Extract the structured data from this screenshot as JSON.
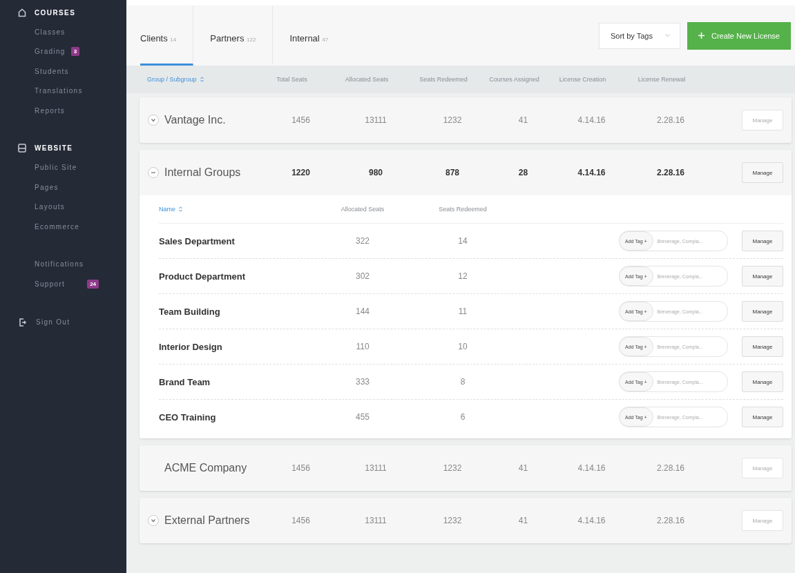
{
  "sidebar": {
    "sections": [
      {
        "title": "COURSES",
        "items": [
          {
            "label": "Classes"
          },
          {
            "label": "Grading",
            "badge": "3"
          },
          {
            "label": "Students"
          },
          {
            "label": "Translations"
          },
          {
            "label": "Reports"
          }
        ]
      },
      {
        "title": "WEBSITE",
        "items": [
          {
            "label": "Public Site"
          },
          {
            "label": "Pages"
          },
          {
            "label": "Layouts"
          },
          {
            "label": "Ecommerce"
          }
        ]
      },
      {
        "items": [
          {
            "label": "Notifications"
          },
          {
            "label": "Support",
            "badge": "24"
          }
        ]
      }
    ],
    "sign_out": "Sign Out"
  },
  "tabs": [
    {
      "label": "Clients",
      "count": "14",
      "selected": true
    },
    {
      "label": "Partners",
      "count": "122",
      "selected": false
    },
    {
      "label": "Internal",
      "count": "47",
      "selected": false
    }
  ],
  "sort_select": {
    "value": "Sort by Tags"
  },
  "create_button": "Create New License",
  "columns": [
    "Group / Subgroup",
    "Total Seats",
    "Allocated Seats",
    "Seats Redeemed",
    "Courses Assigned",
    "License Creation",
    "License Renewal"
  ],
  "groups": [
    {
      "name": "Vantage Inc.",
      "kind": "expandable",
      "expanded": false,
      "values": [
        "1456",
        "13111",
        "1232",
        "41",
        "4.14.16",
        "2.28.16"
      ],
      "action": "Manage"
    },
    {
      "name": "Internal Groups",
      "kind": "expandable",
      "expanded": true,
      "values": [
        "1220",
        "980",
        "878",
        "28",
        "4.14.16",
        "2.28.16"
      ],
      "action": "Manage",
      "sub_columns": [
        "Name",
        "Allocated Seats",
        "Seats Redeemed"
      ],
      "children": [
        {
          "name": "Sales Department",
          "allocated": "322",
          "redeemed": "14",
          "tag_button": "Add Tag +",
          "tags": "Breverage, Compla...",
          "action": "Manage"
        },
        {
          "name": "Product Department",
          "allocated": "302",
          "redeemed": "12",
          "tag_button": "Add Tag +",
          "tags": "Breverage, Compla...",
          "action": "Manage"
        },
        {
          "name": "Team Building",
          "allocated": "144",
          "redeemed": "11",
          "tag_button": "Add Tag +",
          "tags": "Breverage, Compla...",
          "action": "Manage"
        },
        {
          "name": "Interior Design",
          "allocated": "110",
          "redeemed": "10",
          "tag_button": "Add Tag +",
          "tags": "Breverage, Compla...",
          "action": "Manage"
        },
        {
          "name": "Brand Team",
          "allocated": "333",
          "redeemed": "8",
          "tag_button": "Add Tag +",
          "tags": "Breverage, Compla...",
          "action": "Manage"
        },
        {
          "name": "CEO Training",
          "allocated": "455",
          "redeemed": "6",
          "tag_button": "Add Tag +",
          "tags": "Breverage, Compla...",
          "action": "Manage"
        }
      ]
    },
    {
      "name": "ACME Company",
      "kind": "leaf",
      "expanded": false,
      "values": [
        "1456",
        "13111",
        "1232",
        "41",
        "4.14.16",
        "2.28.16"
      ],
      "action": "Manage"
    },
    {
      "name": "External Partners",
      "kind": "expandable",
      "expanded": false,
      "values": [
        "1456",
        "13111",
        "1232",
        "41",
        "4.14.16",
        "2.28.16"
      ],
      "action": "Manage"
    }
  ]
}
